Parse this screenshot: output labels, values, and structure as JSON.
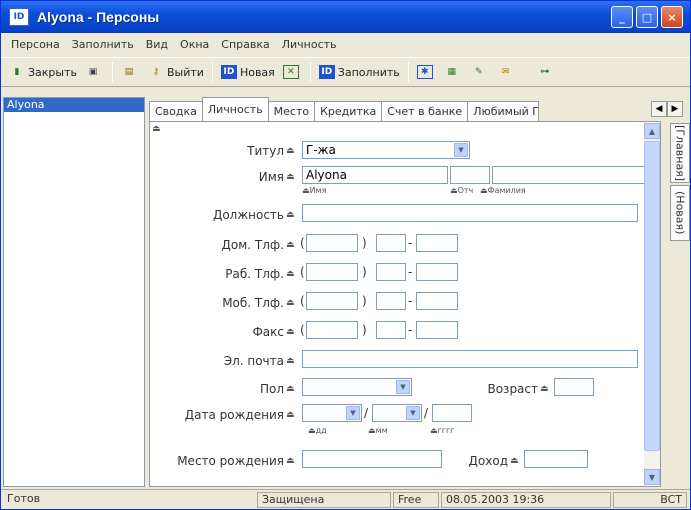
{
  "window": {
    "title": "Alyona - Персоны",
    "app_icon": "ID"
  },
  "menu": [
    "Персона",
    "Заполнить",
    "Вид",
    "Окна",
    "Справка",
    "Личность"
  ],
  "toolbar": {
    "close_label": "Закрыть",
    "exit_label": "Выйти",
    "new_label": "Новая",
    "fill_label": "Заполнить"
  },
  "list": {
    "items": [
      "Alyona"
    ]
  },
  "tabs": [
    "Сводка",
    "Личность",
    "Место",
    "Кредитка",
    "Счет в банке",
    "Любимый Пар"
  ],
  "side_tabs": [
    "[Главная]",
    "(Новая)"
  ],
  "form": {
    "title_label": "Титул",
    "title_value": "Г-жа",
    "name_label": "Имя",
    "name_value": "Alyona",
    "sub_first": "Имя",
    "sub_middle": "Отч",
    "sub_last": "Фамилия",
    "position_label": "Должность",
    "home_phone_label": "Дом. Тлф.",
    "work_phone_label": "Раб. Тлф.",
    "mobile_label": "Моб. Тлф.",
    "fax_label": "Факс",
    "email_label": "Эл. почта",
    "gender_label": "Пол",
    "age_label": "Возраст",
    "birth_date_label": "Дата рождения",
    "sub_day": "дд",
    "sub_month": "мм",
    "sub_year": "гггг",
    "birth_place_label": "Место рождения",
    "income_label": "Доход"
  },
  "status": {
    "ready": "Готов",
    "protected": "Защищена",
    "free": "Free",
    "datetime": "08.05.2003 19:36",
    "bct": "BCT"
  },
  "colors": {
    "titlebar": "#0a4fd8",
    "selection": "#316ac5",
    "face": "#ece9d8"
  }
}
